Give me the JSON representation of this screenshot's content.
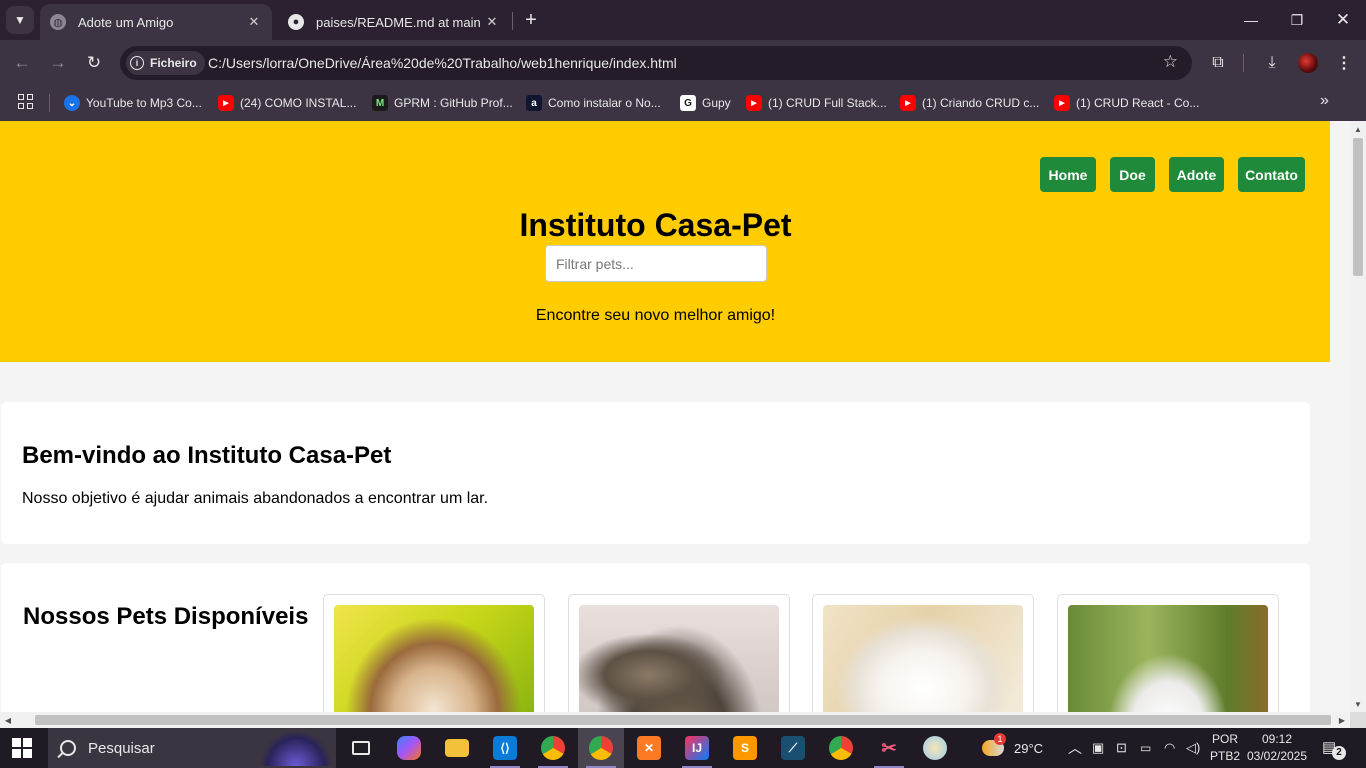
{
  "browser": {
    "tabs": [
      {
        "title": "Adote um Amigo",
        "active": true
      },
      {
        "title": "paises/README.md at main · Ke",
        "active": false
      }
    ],
    "address": {
      "chip_label": "Ficheiro",
      "url": "C:/Users/lorra/OneDrive/Área%20de%20Trabalho/web1henrique/index.html"
    },
    "bookmarks": [
      {
        "label": "YouTube to Mp3 Co...",
        "icon": "download-icon"
      },
      {
        "label": "(24) COMO INSTAL...",
        "icon": "youtube-icon"
      },
      {
        "label": "GPRM : GitHub Prof...",
        "icon": "gprm-icon"
      },
      {
        "label": "Como instalar o No...",
        "icon": "a-letter-icon"
      },
      {
        "label": "Gupy",
        "icon": "gupy-icon"
      },
      {
        "label": "(1) CRUD Full Stack...",
        "icon": "youtube-icon"
      },
      {
        "label": "(1) Criando CRUD c...",
        "icon": "youtube-icon"
      },
      {
        "label": "(1) CRUD React - Co...",
        "icon": "youtube-icon"
      }
    ]
  },
  "page": {
    "nav": [
      "Home",
      "Doe",
      "Adote",
      "Contato"
    ],
    "title": "Instituto Casa-Pet",
    "filter_placeholder": "Filtrar pets...",
    "tagline": "Encontre seu novo melhor amigo!",
    "welcome": {
      "heading": "Bem-vindo ao Instituto Casa-Pet",
      "text": "Nosso objetivo é ajudar animais abandonados a encontrar um lar."
    },
    "pets": {
      "heading": "Nossos Pets Disponíveis",
      "items": [
        {
          "image": "puppy-photo"
        },
        {
          "image": "tabby-cat-photo"
        },
        {
          "image": "white-puppy-photo"
        },
        {
          "image": "white-rabbit-photo"
        }
      ]
    }
  },
  "taskbar": {
    "search_placeholder": "Pesquisar",
    "weather": "29°C",
    "lang_line1": "POR",
    "lang_line2": "PTB2",
    "time": "09:12",
    "date": "03/02/2025",
    "notification_count": "2",
    "weather_badge": "1"
  },
  "colors": {
    "header_bg": "#ffcc00",
    "nav_button": "#1e8a3a",
    "page_bg": "#f4f4f4",
    "browser_frame": "#3c3442"
  }
}
